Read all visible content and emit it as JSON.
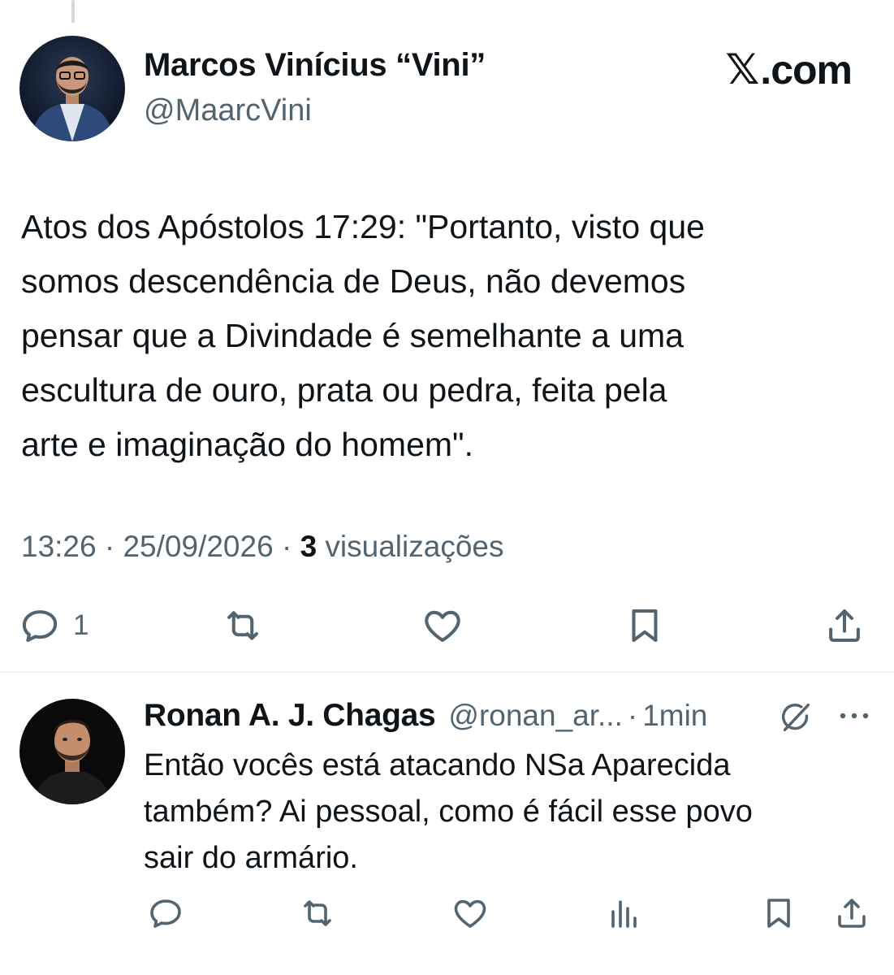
{
  "main_tweet": {
    "author_name": "Marcos Vinícius “Vini”",
    "author_handle": "@MaarcVini",
    "brand": ".com",
    "brand_icon": "x-logo",
    "text_lines": [
      "Atos dos Apóstolos 17:29: \"Portanto, visto que",
      "somos descendência de Deus, não devemos",
      "pensar que a Divindade é semelhante a uma",
      "escultura de ouro, prata ou pedra, feita pela",
      "arte e imaginação do homem\"."
    ],
    "time": "13:26",
    "date": "25/09/2026",
    "views_count": "3",
    "views_label": "visualizações",
    "separator": "·",
    "actions": {
      "reply_count": "1",
      "icons": [
        "reply-icon",
        "repost-icon",
        "like-icon",
        "bookmark-icon",
        "share-icon"
      ]
    }
  },
  "reply": {
    "author_name": "Ronan A. J. Chagas",
    "author_handle": "@ronan_ar...",
    "separator": "·",
    "time": "1min",
    "text_lines": [
      "Então vocês está atacando NSa Aparecida",
      "também? Ai pessoal, como é fácil esse povo",
      "sair do armário."
    ],
    "icons": [
      "grok-icon",
      "more-icon",
      "reply-icon",
      "repost-icon",
      "like-icon",
      "views-icon",
      "bookmark-icon",
      "share-icon"
    ]
  },
  "colors": {
    "text": "#0f1419",
    "secondary": "#536471",
    "divider": "#eff3f4",
    "background": "#ffffff"
  }
}
